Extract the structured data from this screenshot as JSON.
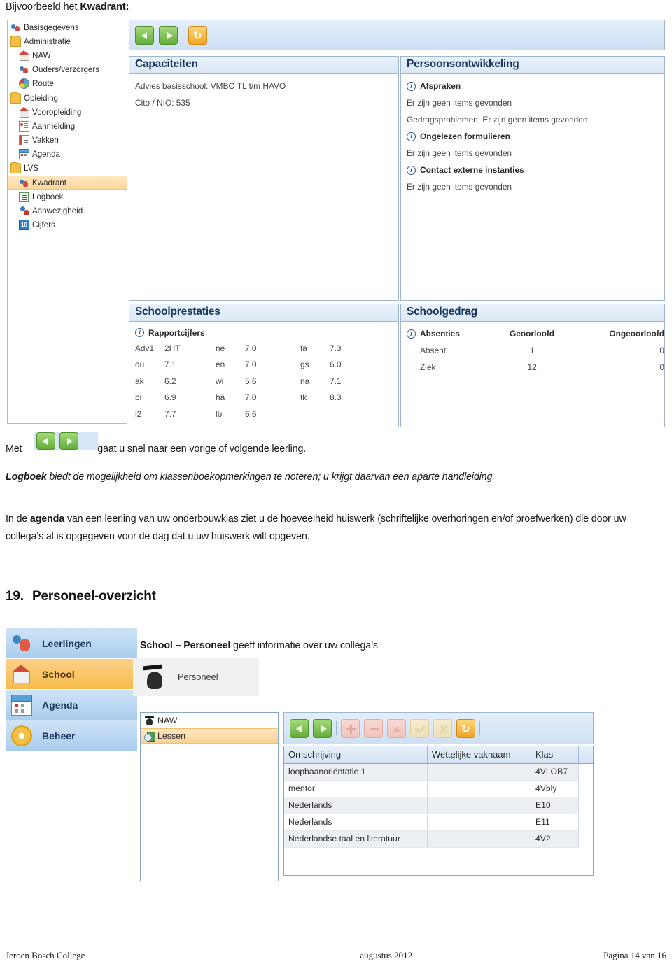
{
  "document": {
    "intro_prefix": "Bijvoorbeeld het ",
    "intro_bold": "Kwadrant:"
  },
  "kwadrant_screenshot": {
    "tree": {
      "items": [
        {
          "label": "Basisgegevens",
          "icon": "people-icon",
          "level": 0,
          "selected": false
        },
        {
          "label": "Administratie",
          "icon": "folder-icon",
          "level": 0,
          "selected": false
        },
        {
          "label": "NAW",
          "icon": "house-icon",
          "level": 1,
          "selected": false
        },
        {
          "label": "Ouders/verzorgers",
          "icon": "people-icon",
          "level": 1,
          "selected": false
        },
        {
          "label": "Route",
          "icon": "globe-icon",
          "level": 1,
          "selected": false
        },
        {
          "label": "Opleiding",
          "icon": "folder-icon",
          "level": 0,
          "selected": false
        },
        {
          "label": "Vooropleiding",
          "icon": "house-icon",
          "level": 1,
          "selected": false
        },
        {
          "label": "Aanmelding",
          "icon": "card-icon",
          "level": 1,
          "selected": false
        },
        {
          "label": "Vakken",
          "icon": "book-icon",
          "level": 1,
          "selected": false
        },
        {
          "label": "Agenda",
          "icon": "calendar-icon",
          "level": 1,
          "selected": false
        },
        {
          "label": "LVS",
          "icon": "folder-icon",
          "level": 0,
          "selected": false
        },
        {
          "label": "Kwadrant",
          "icon": "people-icon",
          "level": 1,
          "selected": true
        },
        {
          "label": "Logboek",
          "icon": "note-icon",
          "level": 1,
          "selected": false
        },
        {
          "label": "Aanwezigheid",
          "icon": "person-question-icon",
          "level": 1,
          "selected": false
        },
        {
          "label": "Cijfers",
          "icon": "ten-icon",
          "level": 1,
          "selected": false,
          "icon_text": "10"
        }
      ]
    },
    "toolbar": {
      "buttons": [
        {
          "name": "previous-button",
          "icon": "arrow-left-icon",
          "style": "green"
        },
        {
          "name": "next-button",
          "icon": "arrow-right-icon",
          "style": "green"
        },
        {
          "name": "refresh-button",
          "icon": "refresh-icon",
          "style": "orange",
          "glyph": "↻"
        }
      ]
    },
    "panels": {
      "capaciteiten": {
        "title": "Capaciteiten",
        "lines": [
          "Advies basisschool: VMBO TL t/m HAVO",
          "Cito / NIO: 535"
        ]
      },
      "persoonsontwikkeling": {
        "title": "Persoonsontwikkeling",
        "groups": [
          {
            "heading": "Afspraken",
            "lines": [
              "Er zijn geen items gevonden",
              "Gedragsproblemen: Er zijn geen items gevonden"
            ]
          },
          {
            "heading": "Ongelezen formulieren",
            "lines": [
              "Er zijn geen items gevonden"
            ]
          },
          {
            "heading": "Contact externe instanties",
            "lines": [
              "Er zijn geen items gevonden"
            ]
          }
        ]
      },
      "schoolprestaties": {
        "title": "Schoolprestaties",
        "subheading": "Rapportcijfers",
        "rows": [
          [
            "Adv1",
            "2HT",
            "ne",
            "7.0",
            "fa",
            "7.3"
          ],
          [
            "du",
            "7.1",
            "en",
            "7.0",
            "gs",
            "6.0"
          ],
          [
            "ak",
            "6.2",
            "wi",
            "5.6",
            "na",
            "7.1"
          ],
          [
            "bi",
            "6.9",
            "ha",
            "7.0",
            "tk",
            "8.3"
          ],
          [
            "l2",
            "7.7",
            "lb",
            "6.6",
            "",
            ""
          ]
        ]
      },
      "schoolgedrag": {
        "title": "Schoolgedrag",
        "columns": [
          "Absenties",
          "Geoorloofd",
          "Ongeoorloofd"
        ],
        "rows": [
          [
            "Absent",
            "1",
            "0"
          ],
          [
            "Ziek",
            "12",
            "0"
          ]
        ]
      }
    }
  },
  "body_text": {
    "met_prefix": "Met",
    "met_suffix": "gaat u snel naar een vorige of volgende leerling.",
    "logboek_bold": "Logboek",
    "logboek_rest": " biedt de mogelijkheid om klassenboekopmerkingen te noteren; u krijgt daarvan een aparte handleiding.",
    "agenda_p1": "In de ",
    "agenda_bold": "agenda",
    "agenda_p2": " van een leerling van uw onderbouwklas ziet u de hoeveelheid huiswerk (schriftelijke overhoringen en/of proefwerken) die door uw collega’s al is opgegeven voor de dag dat u uw huiswerk wilt opgeven."
  },
  "section": {
    "number": "19.",
    "title": "Personeel-overzicht"
  },
  "personeel_screenshot": {
    "nav_tabs": [
      {
        "label": "Leerlingen",
        "icon": "people-icon",
        "selected": false
      },
      {
        "label": "School",
        "icon": "house-icon",
        "selected": true
      },
      {
        "label": "Agenda",
        "icon": "calendar-icon",
        "selected": false
      },
      {
        "label": "Beheer",
        "icon": "gear-icon",
        "selected": false
      }
    ],
    "caption_bold": "School – Personeel",
    "caption_rest": " geeft informatie over uw collega’s",
    "personeel_tile": {
      "label": "Personeel",
      "icon": "graduate-icon"
    },
    "subtree": [
      {
        "label": "NAW",
        "icon": "graduate-icon",
        "selected": false
      },
      {
        "label": "Lessen",
        "icon": "lesson-icon",
        "selected": true
      }
    ],
    "toolbar": {
      "buttons": [
        {
          "name": "previous-button",
          "icon": "arrow-left-icon",
          "style": "green"
        },
        {
          "name": "next-button",
          "icon": "arrow-right-icon",
          "style": "green"
        },
        {
          "name": "add-button",
          "icon": "plus-icon",
          "style": "red-d"
        },
        {
          "name": "remove-button",
          "icon": "minus-icon",
          "style": "red-d"
        },
        {
          "name": "edit-button",
          "icon": "arrow-up-icon",
          "style": "red-d"
        },
        {
          "name": "confirm-button",
          "icon": "check-icon",
          "style": "tan-d"
        },
        {
          "name": "cancel-button",
          "icon": "cross-icon",
          "style": "tan-d"
        },
        {
          "name": "refresh-button",
          "icon": "refresh-icon",
          "style": "orange",
          "glyph": "↻"
        }
      ]
    },
    "grid": {
      "columns": [
        "Omschrijving",
        "Wettelijke vaknaam",
        "Klas"
      ],
      "rows": [
        [
          "loopbaanoriëntatie 1",
          "",
          "4VLOB7"
        ],
        [
          "mentor",
          "",
          "4Vbly"
        ],
        [
          "Nederlands",
          "",
          "E10"
        ],
        [
          "Nederlands",
          "",
          "E11"
        ],
        [
          "Nederlandse taal en literatuur",
          "",
          "4V2"
        ]
      ]
    }
  },
  "footer": {
    "left": "Jeroen Bosch College",
    "center": "augustus 2012",
    "right": "Pagina 14 van 16"
  }
}
